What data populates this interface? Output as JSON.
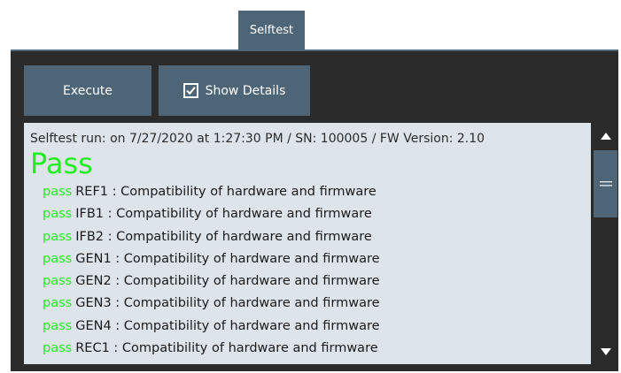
{
  "tab": {
    "label": "Selftest"
  },
  "toolbar": {
    "execute_label": "Execute",
    "show_details_label": "Show Details",
    "show_details_checked": true
  },
  "log": {
    "header": "Selftest run: on 7/27/2020 at 1:27:30 PM / SN: 100005 / FW Version: 2.10",
    "result": "Pass",
    "lines": [
      {
        "status": "pass",
        "text": "REF1 : Compatibility of hardware and firmware"
      },
      {
        "status": "pass",
        "text": "IFB1 : Compatibility of hardware and firmware"
      },
      {
        "status": "pass",
        "text": "IFB2 : Compatibility of hardware and firmware"
      },
      {
        "status": "pass",
        "text": "GEN1 : Compatibility of hardware and firmware"
      },
      {
        "status": "pass",
        "text": "GEN2 : Compatibility of hardware and firmware"
      },
      {
        "status": "pass",
        "text": "GEN3 : Compatibility of hardware and firmware"
      },
      {
        "status": "pass",
        "text": "GEN4 : Compatibility of hardware and firmware"
      },
      {
        "status": "pass",
        "text": "REC1 : Compatibility of hardware and firmware"
      }
    ]
  },
  "icons": {
    "checkbox": "checkmark-icon",
    "scroll_up": "arrow-up-icon",
    "scroll_down": "arrow-down-icon",
    "scroll_thumb": "grip-icon"
  },
  "colors": {
    "accent": "#4e6578",
    "panel_background": "#2b2b2b",
    "log_background": "#dde4ea",
    "pass_green": "#22ee22"
  }
}
